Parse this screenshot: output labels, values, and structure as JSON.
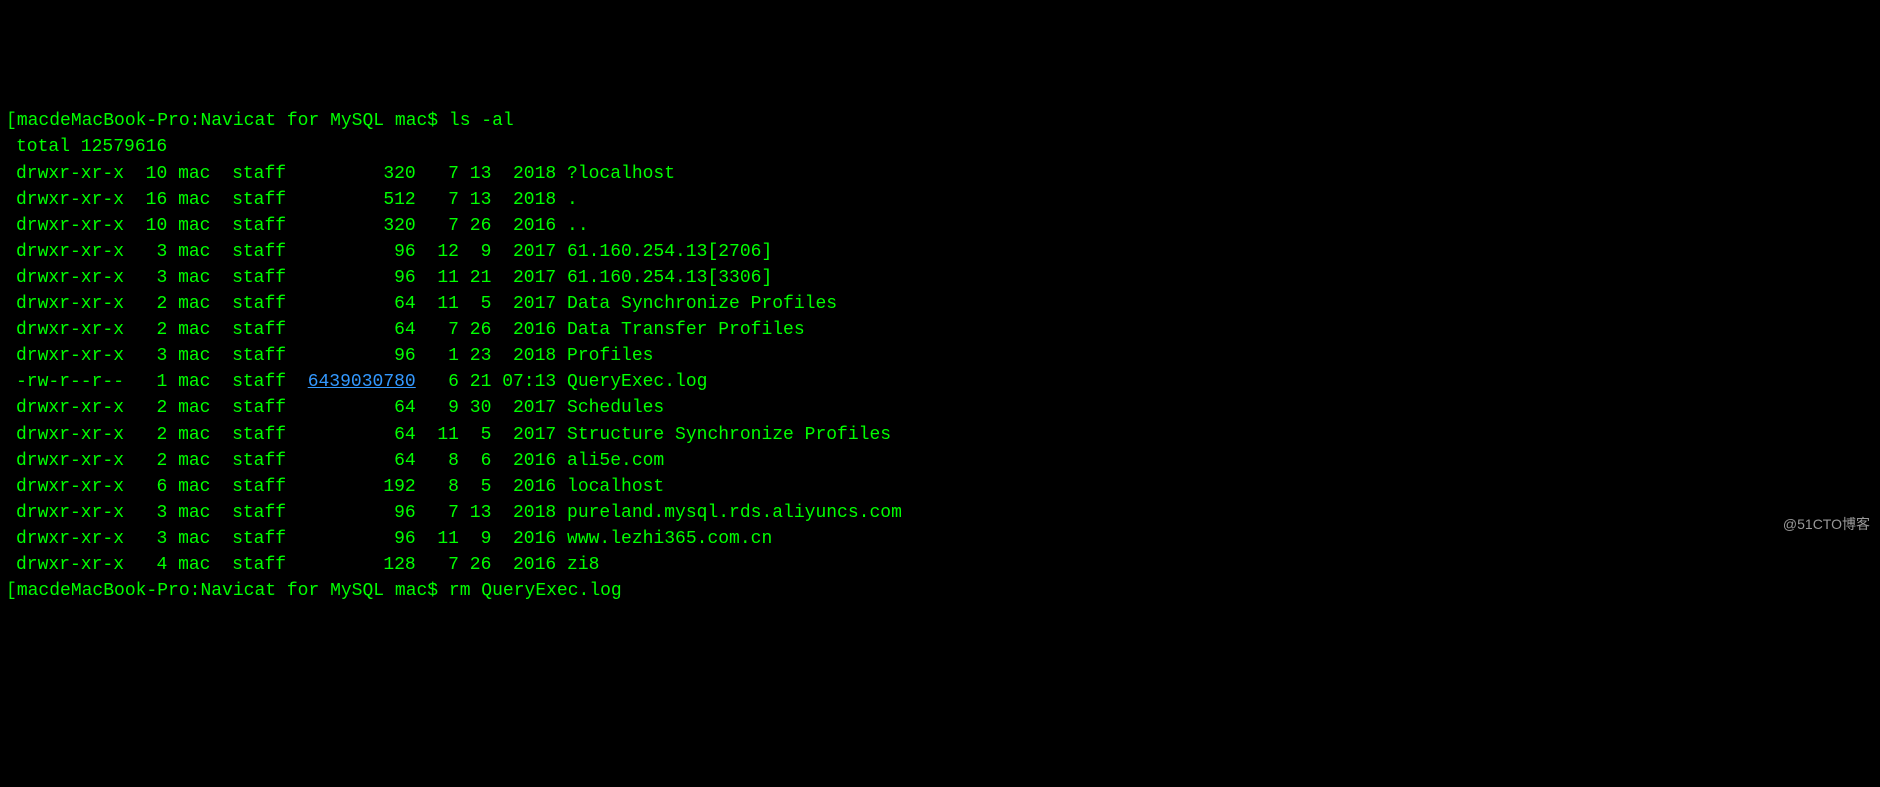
{
  "prompt1": {
    "bracket_open": "[",
    "host": "macdeMacBook-Pro",
    "sep": ":",
    "path": "Navicat for MySQL",
    "user": " mac$ ",
    "command": "ls -al"
  },
  "total_line": "total 12579616",
  "listing": [
    {
      "perms": "drwxr-xr-x",
      "links": "10",
      "owner": "mac",
      "group": "staff",
      "size": "320",
      "month": "7",
      "day": "13",
      "time": "2018",
      "name": "?localhost",
      "hl": false
    },
    {
      "perms": "drwxr-xr-x",
      "links": "16",
      "owner": "mac",
      "group": "staff",
      "size": "512",
      "month": "7",
      "day": "13",
      "time": "2018",
      "name": ".",
      "hl": false
    },
    {
      "perms": "drwxr-xr-x",
      "links": "10",
      "owner": "mac",
      "group": "staff",
      "size": "320",
      "month": "7",
      "day": "26",
      "time": "2016",
      "name": "..",
      "hl": false
    },
    {
      "perms": "drwxr-xr-x",
      "links": "3",
      "owner": "mac",
      "group": "staff",
      "size": "96",
      "month": "12",
      "day": "9",
      "time": "2017",
      "name": "61.160.254.13[2706]",
      "hl": false
    },
    {
      "perms": "drwxr-xr-x",
      "links": "3",
      "owner": "mac",
      "group": "staff",
      "size": "96",
      "month": "11",
      "day": "21",
      "time": "2017",
      "name": "61.160.254.13[3306]",
      "hl": false
    },
    {
      "perms": "drwxr-xr-x",
      "links": "2",
      "owner": "mac",
      "group": "staff",
      "size": "64",
      "month": "11",
      "day": "5",
      "time": "2017",
      "name": "Data Synchronize Profiles",
      "hl": false
    },
    {
      "perms": "drwxr-xr-x",
      "links": "2",
      "owner": "mac",
      "group": "staff",
      "size": "64",
      "month": "7",
      "day": "26",
      "time": "2016",
      "name": "Data Transfer Profiles",
      "hl": false
    },
    {
      "perms": "drwxr-xr-x",
      "links": "3",
      "owner": "mac",
      "group": "staff",
      "size": "96",
      "month": "1",
      "day": "23",
      "time": "2018",
      "name": "Profiles",
      "hl": false
    },
    {
      "perms": "-rw-r--r--",
      "links": "1",
      "owner": "mac",
      "group": "staff",
      "size": "6439030780",
      "month": "6",
      "day": "21",
      "time": "07:13",
      "name": "QueryExec.log",
      "hl": true
    },
    {
      "perms": "drwxr-xr-x",
      "links": "2",
      "owner": "mac",
      "group": "staff",
      "size": "64",
      "month": "9",
      "day": "30",
      "time": "2017",
      "name": "Schedules",
      "hl": false
    },
    {
      "perms": "drwxr-xr-x",
      "links": "2",
      "owner": "mac",
      "group": "staff",
      "size": "64",
      "month": "11",
      "day": "5",
      "time": "2017",
      "name": "Structure Synchronize Profiles",
      "hl": false
    },
    {
      "perms": "drwxr-xr-x",
      "links": "2",
      "owner": "mac",
      "group": "staff",
      "size": "64",
      "month": "8",
      "day": "6",
      "time": "2016",
      "name": "ali5e.com",
      "hl": false
    },
    {
      "perms": "drwxr-xr-x",
      "links": "6",
      "owner": "mac",
      "group": "staff",
      "size": "192",
      "month": "8",
      "day": "5",
      "time": "2016",
      "name": "localhost",
      "hl": false
    },
    {
      "perms": "drwxr-xr-x",
      "links": "3",
      "owner": "mac",
      "group": "staff",
      "size": "96",
      "month": "7",
      "day": "13",
      "time": "2018",
      "name": "pureland.mysql.rds.aliyuncs.com",
      "hl": false
    },
    {
      "perms": "drwxr-xr-x",
      "links": "3",
      "owner": "mac",
      "group": "staff",
      "size": "96",
      "month": "11",
      "day": "9",
      "time": "2016",
      "name": "www.lezhi365.com.cn",
      "hl": false
    },
    {
      "perms": "drwxr-xr-x",
      "links": "4",
      "owner": "mac",
      "group": "staff",
      "size": "128",
      "month": "7",
      "day": "26",
      "time": "2016",
      "name": "zi8",
      "hl": false
    }
  ],
  "prompt2": {
    "bracket_open": "[",
    "host": "macdeMacBook-Pro",
    "sep": ":",
    "path": "Navicat for MySQL",
    "user": " mac$ ",
    "command": "rm QueryExec.log"
  },
  "watermark": "@51CTO博客"
}
